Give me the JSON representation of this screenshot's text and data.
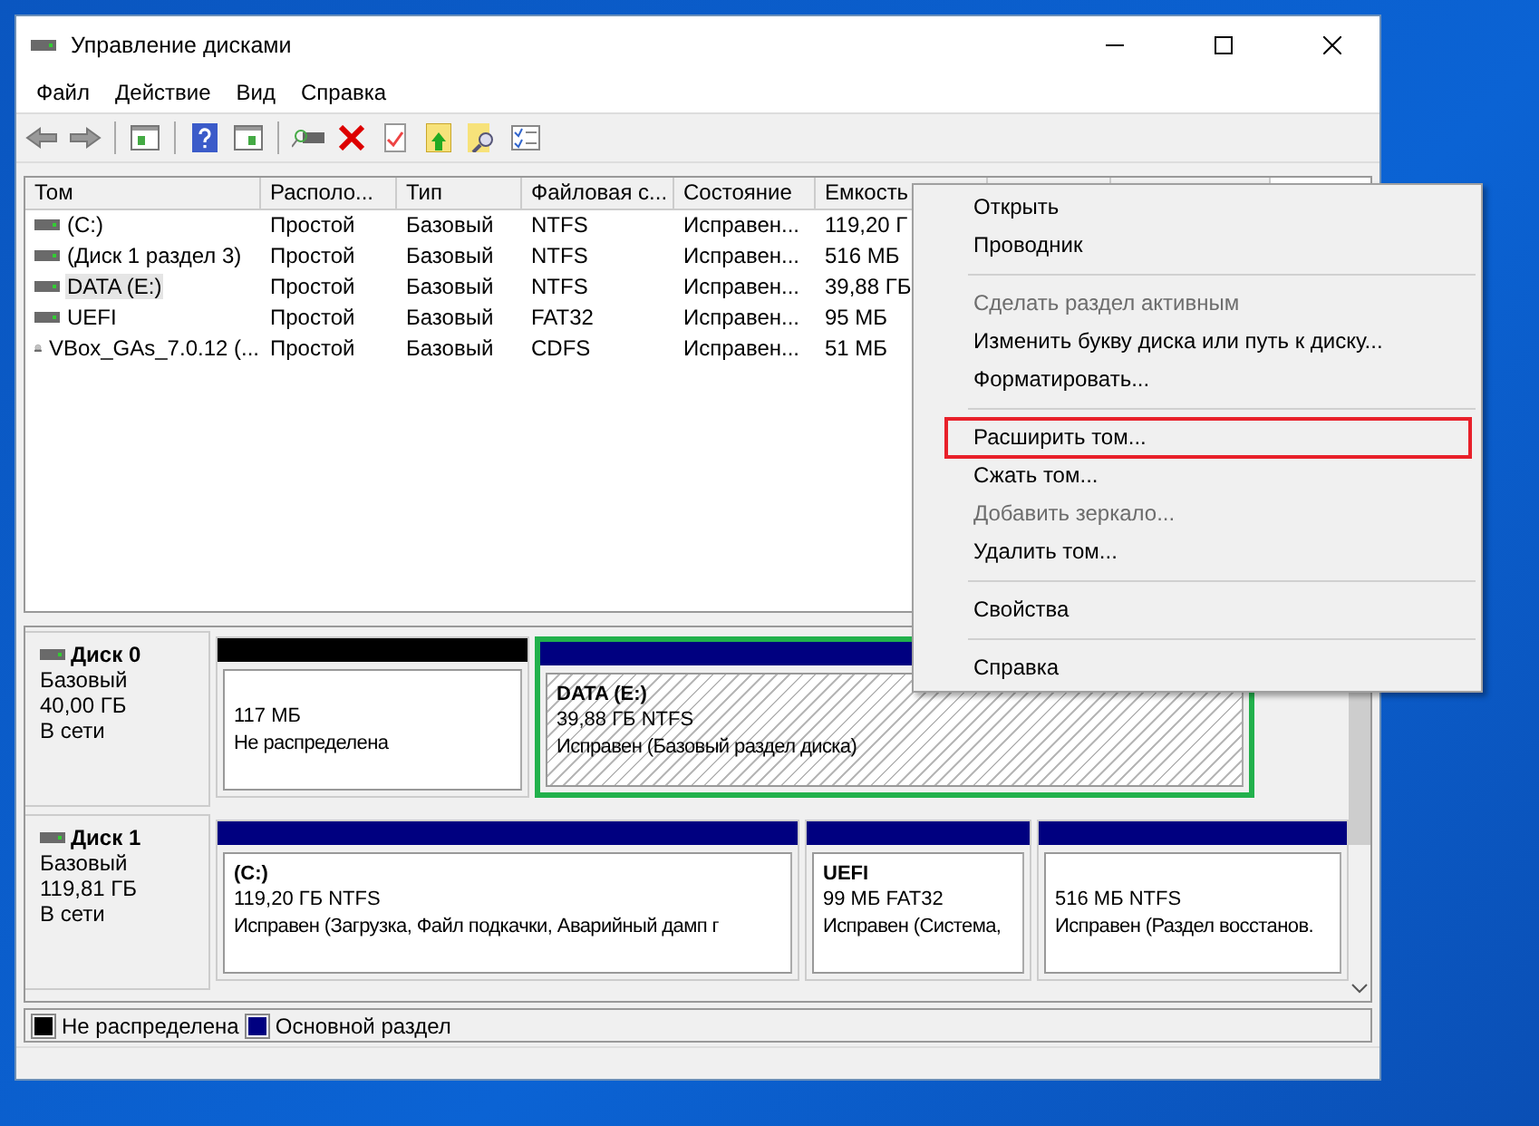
{
  "window": {
    "title": "Управление дисками"
  },
  "menu_bar": [
    "Файл",
    "Действие",
    "Вид",
    "Справка"
  ],
  "volume_table": {
    "columns": [
      "Том",
      "Располо...",
      "Тип",
      "Файловая с...",
      "Состояние",
      "Емкость",
      "",
      ""
    ],
    "rows": [
      {
        "cells": [
          "(C:)",
          "Простой",
          "Базовый",
          "NTFS",
          "Исправен...",
          "119,20 Г"
        ],
        "kind": "disk",
        "selected": false
      },
      {
        "cells": [
          "(Диск 1 раздел 3)",
          "Простой",
          "Базовый",
          "NTFS",
          "Исправен...",
          "516 МБ"
        ],
        "kind": "disk",
        "selected": false
      },
      {
        "cells": [
          "DATA (E:)",
          "Простой",
          "Базовый",
          "NTFS",
          "Исправен...",
          "39,88 ГБ"
        ],
        "kind": "disk",
        "selected": true
      },
      {
        "cells": [
          "UEFI",
          "Простой",
          "Базовый",
          "FAT32",
          "Исправен...",
          "95 МБ"
        ],
        "kind": "disk",
        "selected": false
      },
      {
        "cells": [
          "VBox_GAs_7.0.12 (...",
          "Простой",
          "Базовый",
          "CDFS",
          "Исправен...",
          "51 МБ"
        ],
        "kind": "cd",
        "selected": false
      }
    ]
  },
  "disks": [
    {
      "name": "Диск 0",
      "type": "Базовый",
      "size": "40,00 ГБ",
      "status": "В сети",
      "partitions": [
        {
          "kind": "unallocated",
          "size": "117 МБ",
          "status": "Не распределена",
          "selected": false
        },
        {
          "kind": "primary",
          "label": "DATA  (E:)",
          "size": "39,88 ГБ NTFS",
          "status": "Исправен (Базовый раздел диска)",
          "selected": true
        }
      ]
    },
    {
      "name": "Диск 1",
      "type": "Базовый",
      "size": "119,81 ГБ",
      "status": "В сети",
      "partitions": [
        {
          "kind": "primary",
          "label": "(C:)",
          "size": "119,20 ГБ NTFS",
          "status": "Исправен (Загрузка, Файл подкачки, Аварийный дамп г",
          "selected": false
        },
        {
          "kind": "primary",
          "label": "UEFI",
          "size": "99 МБ FAT32",
          "status": "Исправен (Система,",
          "selected": false
        },
        {
          "kind": "primary",
          "size": "516 МБ NTFS",
          "status": "Исправен (Раздел восстанов.",
          "selected": false
        }
      ]
    }
  ],
  "legend": [
    {
      "label": "Не распределена",
      "color": "#000000"
    },
    {
      "label": "Основной раздел",
      "color": "#000080"
    }
  ],
  "context_menu": [
    {
      "kind": "item",
      "label": "Открыть",
      "disabled": false,
      "highlighted": false
    },
    {
      "kind": "item",
      "label": "Проводник",
      "disabled": false,
      "highlighted": false
    },
    {
      "kind": "separator"
    },
    {
      "kind": "item",
      "label": "Сделать раздел активным",
      "disabled": true,
      "highlighted": false
    },
    {
      "kind": "item",
      "label": "Изменить букву диска или путь к диску...",
      "disabled": false,
      "highlighted": false
    },
    {
      "kind": "item",
      "label": "Форматировать...",
      "disabled": false,
      "highlighted": false
    },
    {
      "kind": "separator"
    },
    {
      "kind": "item",
      "label": "Расширить том...",
      "disabled": false,
      "highlighted": true
    },
    {
      "kind": "item",
      "label": "Сжать том...",
      "disabled": false,
      "highlighted": false
    },
    {
      "kind": "item",
      "label": "Добавить зеркало...",
      "disabled": true,
      "highlighted": false
    },
    {
      "kind": "item",
      "label": "Удалить том...",
      "disabled": false,
      "highlighted": false
    },
    {
      "kind": "separator"
    },
    {
      "kind": "item",
      "label": "Свойства",
      "disabled": false,
      "highlighted": false
    },
    {
      "kind": "separator"
    },
    {
      "kind": "item",
      "label": "Справка",
      "disabled": false,
      "highlighted": false
    }
  ]
}
